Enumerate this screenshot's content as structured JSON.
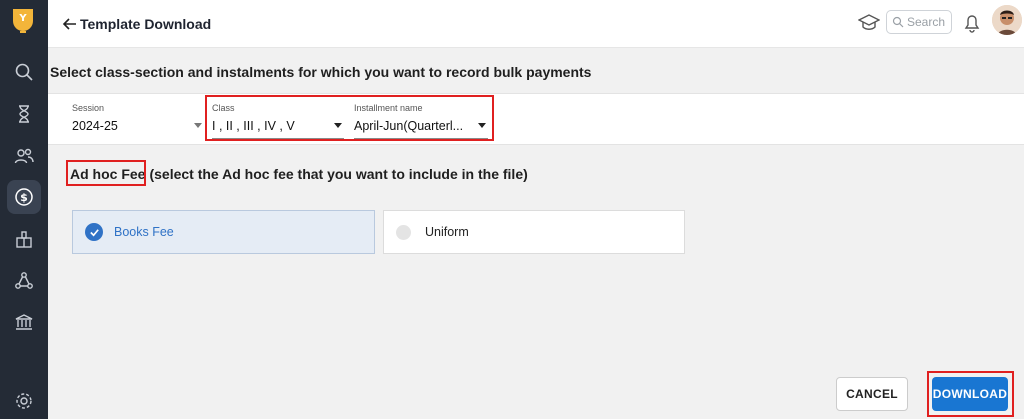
{
  "header": {
    "title": "Template Download",
    "search_placeholder": "Search"
  },
  "sidebar": {
    "items": [
      {
        "icon": "search-icon"
      },
      {
        "icon": "hourglass-icon"
      },
      {
        "icon": "users-icon"
      },
      {
        "icon": "dollar-icon",
        "active": true
      },
      {
        "icon": "gift-icon"
      },
      {
        "icon": "network-icon"
      },
      {
        "icon": "library-icon"
      },
      {
        "icon": "settings-icon"
      }
    ]
  },
  "main": {
    "heading": "Select class-section and instalments for which you want to record bulk payments",
    "filters": {
      "session": {
        "label": "Session",
        "value": "2024-25"
      },
      "class": {
        "label": "Class",
        "value": "I , II , III , IV , V"
      },
      "installment": {
        "label": "Installment name",
        "value": "April-Jun(Quarterl..."
      }
    },
    "adhoc": {
      "title": "Ad hoc Fee",
      "description": "(select the Ad hoc fee that you want to include in the file)",
      "options": [
        {
          "label": "Books Fee",
          "selected": true
        },
        {
          "label": "Uniform",
          "selected": false
        }
      ]
    },
    "actions": {
      "cancel": "CANCEL",
      "download": "DOWNLOAD"
    }
  },
  "colors": {
    "sidebar_bg": "#242b36",
    "accent": "#1976d2",
    "highlight_red": "#e02020",
    "selected_bg": "#e5ecf5"
  }
}
